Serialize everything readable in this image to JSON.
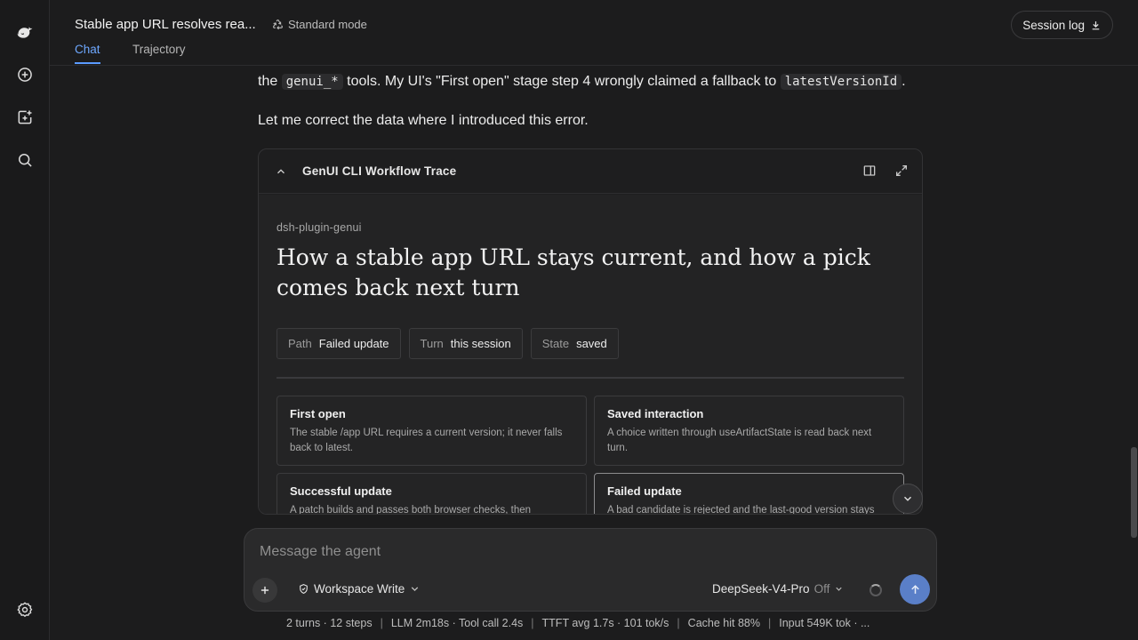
{
  "app": {
    "logo_icon": "whale-logo-icon",
    "nav_icons": [
      "new-chat-icon",
      "new-project-icon",
      "search-icon"
    ],
    "settings_icon": "gear-icon"
  },
  "header": {
    "title": "Stable app URL resolves rea...",
    "mode": "Standard mode",
    "tabs": [
      {
        "label": "Chat",
        "active": true
      },
      {
        "label": "Trajectory",
        "active": false
      }
    ],
    "session_log": "Session log"
  },
  "message": {
    "line1_a": "the",
    "line1_code1": "genui_*",
    "line1_b": "tools. My UI's \"First open\" stage step 4 wrongly claimed a fallback to",
    "line1_code2": "latestVersionId",
    "line1_c": ".",
    "line2": "Let me correct the data where I introduced this error."
  },
  "artifact": {
    "title": "GenUI CLI Workflow Trace",
    "plugin": "dsh-plugin-genui",
    "headline": "How a stable app URL stays current, and how a pick comes back next turn",
    "chips": [
      {
        "key": "Path",
        "value": "Failed update"
      },
      {
        "key": "Turn",
        "value": "this session"
      },
      {
        "key": "State",
        "value": "saved"
      }
    ],
    "stages": [
      {
        "title": "First open",
        "desc": "The stable /app URL requires a current version; it never falls back to latest.",
        "selected": false
      },
      {
        "title": "Saved interaction",
        "desc": "A choice written through useArtifactState is read back next turn.",
        "selected": false
      },
      {
        "title": "Successful update",
        "desc": "A patch builds and passes both browser checks, then",
        "selected": false
      },
      {
        "title": "Failed update",
        "desc": "A bad candidate is rejected and the last-good version stays",
        "selected": true
      }
    ]
  },
  "composer": {
    "placeholder": "Message the agent",
    "workspace": "Workspace Write",
    "model": "DeepSeek-V4-Pro",
    "thinking": "Off"
  },
  "status": {
    "turns": "2 turns · 12 steps",
    "timing": "LLM 2m18s · Tool call 2.4s",
    "ttft": "TTFT avg 1.7s · 101 tok/s",
    "cache": "Cache hit 88%",
    "input": "Input 549K tok · ..."
  }
}
